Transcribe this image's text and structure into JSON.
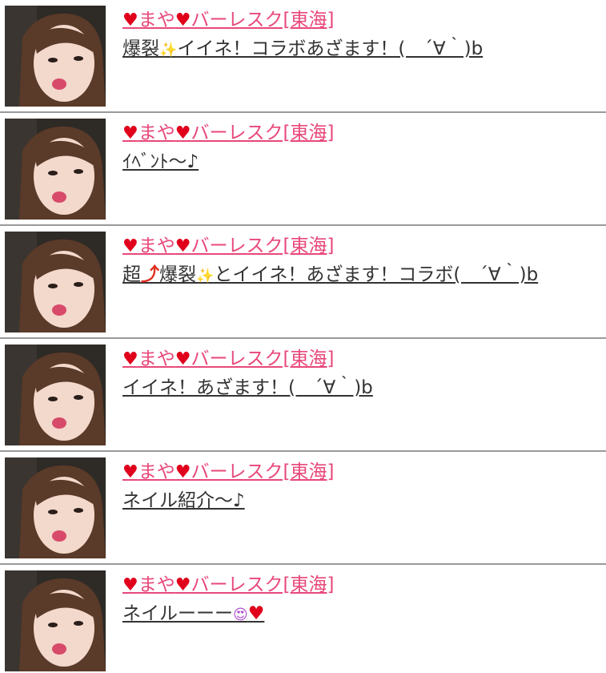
{
  "colors": {
    "name_color": "#e8487a",
    "heart_color": "#e0001b",
    "message_color": "#333333",
    "divider_color": "#9a9a9a"
  },
  "posts": [
    {
      "heart": "♥",
      "name_part1": "まや",
      "heart2": "♥",
      "name_part2": "バーレスク[東海]",
      "msg_part1": "爆裂",
      "emoji1": "✨",
      "msg_part2": "イイネ！コラボあざます！(　´∀｀)b",
      "emoji2": "",
      "msg_part3": "",
      "emoji3": ""
    },
    {
      "heart": "♥",
      "name_part1": "まや",
      "heart2": "♥",
      "name_part2": "バーレスク[東海]",
      "msg_part1": "ｲﾍﾞﾝﾄ〜♪",
      "emoji1": "",
      "msg_part2": "",
      "emoji2": "",
      "msg_part3": "",
      "emoji3": ""
    },
    {
      "heart": "♥",
      "name_part1": "まや",
      "heart2": "♥",
      "name_part2": "バーレスク[東海]",
      "msg_part1": "超",
      "emoji1": "⤴",
      "msg_part2": "爆裂",
      "emoji2": "✨",
      "msg_part3": "とイイネ！あざます！コラボ(　´∀｀)b",
      "emoji3": ""
    },
    {
      "heart": "♥",
      "name_part1": "まや",
      "heart2": "♥",
      "name_part2": "バーレスク[東海]",
      "msg_part1": "イイネ！あざます！(　´∀｀)b",
      "emoji1": "",
      "msg_part2": "",
      "emoji2": "",
      "msg_part3": "",
      "emoji3": ""
    },
    {
      "heart": "♥",
      "name_part1": "まや",
      "heart2": "♥",
      "name_part2": "バーレスク[東海]",
      "msg_part1": "ネイル紹介〜♪",
      "emoji1": "",
      "msg_part2": "",
      "emoji2": "",
      "msg_part3": "",
      "emoji3": ""
    },
    {
      "heart": "♥",
      "name_part1": "まや",
      "heart2": "♥",
      "name_part2": "バーレスク[東海]",
      "msg_part1": "ネイルーーー",
      "emoji1": "😍",
      "msg_part2": "",
      "emoji2": "♥",
      "msg_part3": "",
      "emoji3": ""
    }
  ]
}
